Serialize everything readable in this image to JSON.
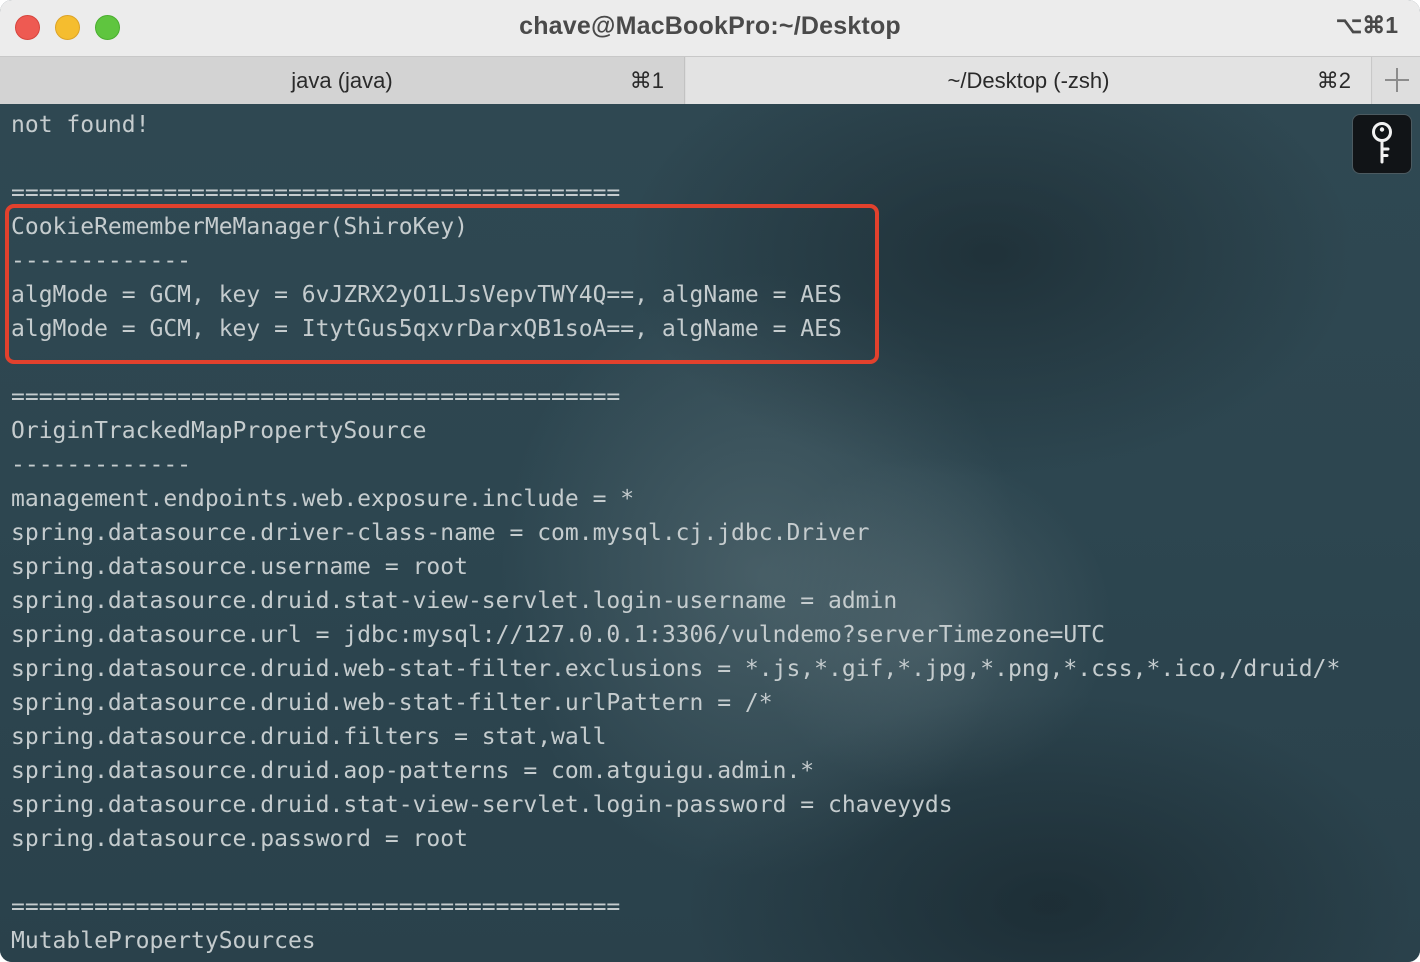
{
  "window": {
    "title": "chave@MacBookPro:~/Desktop",
    "shortcut": "⌥⌘1"
  },
  "tabs": [
    {
      "label": "java (java)",
      "shortcut": "⌘1",
      "active": true
    },
    {
      "label": "~/Desktop (-zsh)",
      "shortcut": "⌘2",
      "active": false
    }
  ],
  "icons": {
    "new_tab": "plus-icon",
    "keychain": "key-icon"
  },
  "colors": {
    "highlight": "#e2412d",
    "terminal_text": "#c5ccce"
  },
  "terminal": {
    "lines": [
      "not found!",
      "",
      "============================================",
      "CookieRememberMeManager(ShiroKey)",
      "-------------",
      "algMode = GCM, key = 6vJZRX2yO1LJsVepvTWY4Q==, algName = AES",
      "algMode = GCM, key = ItytGus5qxvrDarxQB1soA==, algName = AES",
      "",
      "============================================",
      "OriginTrackedMapPropertySource",
      "-------------",
      "management.endpoints.web.exposure.include = *",
      "spring.datasource.driver-class-name = com.mysql.cj.jdbc.Driver",
      "spring.datasource.username = root",
      "spring.datasource.druid.stat-view-servlet.login-username = admin",
      "spring.datasource.url = jdbc:mysql://127.0.0.1:3306/vulndemo?serverTimezone=UTC",
      "spring.datasource.druid.web-stat-filter.exclusions = *.js,*.gif,*.jpg,*.png,*.css,*.ico,/druid/*",
      "spring.datasource.druid.web-stat-filter.urlPattern = /*",
      "spring.datasource.druid.filters = stat,wall",
      "spring.datasource.druid.aop-patterns = com.atguigu.admin.*",
      "spring.datasource.druid.stat-view-servlet.login-password = chaveyyds",
      "spring.datasource.password = root",
      "",
      "============================================",
      "MutablePropertySources"
    ]
  }
}
